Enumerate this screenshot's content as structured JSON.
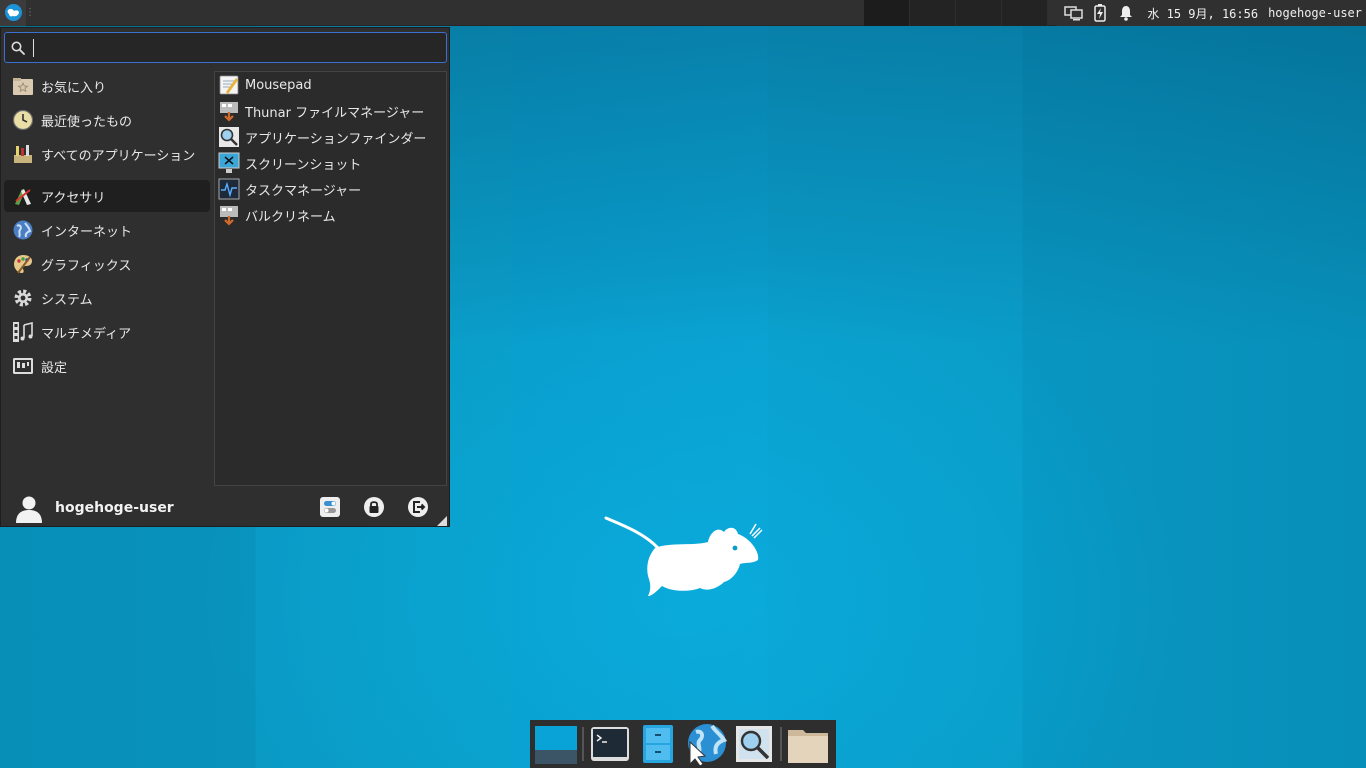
{
  "top_panel": {
    "menu_button_icon": "xfce-logo-icon",
    "tray_icons": [
      "network-icon",
      "battery-icon",
      "bell-icon"
    ],
    "clock": "水 15  9月, 16:56",
    "user": "hogehoge-user"
  },
  "menu": {
    "search": {
      "value": "",
      "placeholder": ""
    },
    "categories": [
      {
        "label": "お気に入り",
        "icon": "star-folder-icon"
      },
      {
        "label": "最近使ったもの",
        "icon": "clock-icon"
      },
      {
        "label": "すべてのアプリケーション",
        "icon": "all-apps-icon"
      },
      {
        "label": "アクセサリ",
        "icon": "accessories-icon",
        "active": true
      },
      {
        "label": "インターネット",
        "icon": "globe-icon"
      },
      {
        "label": "グラフィックス",
        "icon": "palette-icon"
      },
      {
        "label": "システム",
        "icon": "gear-icon"
      },
      {
        "label": "マルチメディア",
        "icon": "music-icon"
      },
      {
        "label": "設定",
        "icon": "settings-icon"
      }
    ],
    "apps": [
      {
        "label": "Mousepad",
        "icon": "text-editor-icon"
      },
      {
        "label": "Thunar ファイルマネージャー",
        "icon": "file-manager-icon"
      },
      {
        "label": "アプリケーションファインダー",
        "icon": "magnifier-icon"
      },
      {
        "label": "スクリーンショット",
        "icon": "screenshot-icon"
      },
      {
        "label": "タスクマネージャー",
        "icon": "task-manager-icon"
      },
      {
        "label": "バルクリネーム",
        "icon": "bulk-rename-icon"
      }
    ],
    "footer": {
      "username": "hogehoge-user",
      "buttons": [
        "settings-toggle-icon",
        "lock-icon",
        "logout-icon"
      ]
    }
  },
  "dock": {
    "items": [
      "show-desktop-icon",
      "terminal-icon",
      "file-manager-icon",
      "web-browser-icon",
      "app-finder-icon",
      "folder-icon"
    ]
  }
}
